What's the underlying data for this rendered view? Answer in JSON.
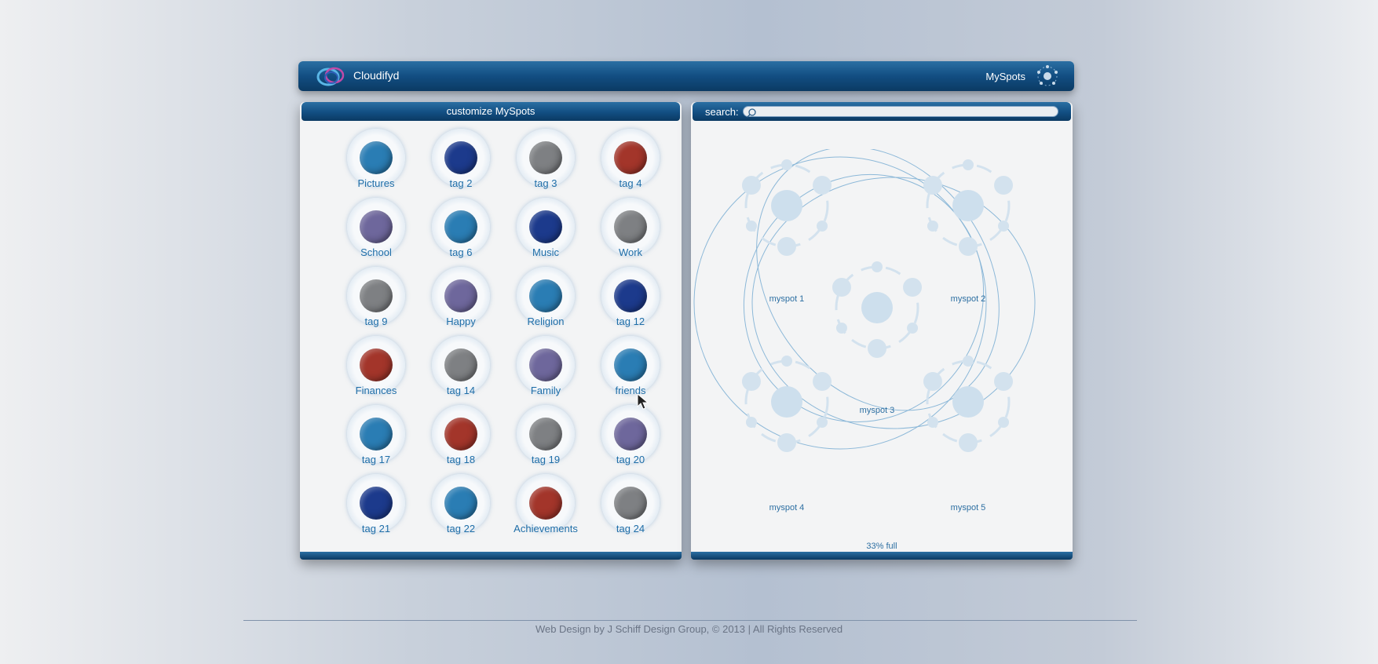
{
  "header": {
    "app_name": "Cloudifyd",
    "myspots_label": "MySpots"
  },
  "left_panel": {
    "title": "customize MySpots",
    "tags": [
      {
        "label": "Pictures",
        "color": "teal-blue"
      },
      {
        "label": "tag 2",
        "color": "navy"
      },
      {
        "label": "tag 3",
        "color": "gray"
      },
      {
        "label": "tag 4",
        "color": "red"
      },
      {
        "label": "School",
        "color": "purple"
      },
      {
        "label": "tag 6",
        "color": "teal-blue"
      },
      {
        "label": "Music",
        "color": "navy"
      },
      {
        "label": "Work",
        "color": "gray"
      },
      {
        "label": "tag 9",
        "color": "gray"
      },
      {
        "label": "Happy",
        "color": "purple"
      },
      {
        "label": "Religion",
        "color": "teal-blue"
      },
      {
        "label": "tag 12",
        "color": "navy"
      },
      {
        "label": "Finances",
        "color": "red"
      },
      {
        "label": "tag 14",
        "color": "gray"
      },
      {
        "label": "Family",
        "color": "purple"
      },
      {
        "label": "friends",
        "color": "teal-blue"
      },
      {
        "label": "tag 17",
        "color": "teal-blue"
      },
      {
        "label": "tag 18",
        "color": "red"
      },
      {
        "label": "tag 19",
        "color": "gray"
      },
      {
        "label": "tag 20",
        "color": "purple"
      },
      {
        "label": "tag 21",
        "color": "navy"
      },
      {
        "label": "tag 22",
        "color": "teal-blue"
      },
      {
        "label": "Achievements",
        "color": "red"
      },
      {
        "label": "tag 24",
        "color": "gray"
      }
    ]
  },
  "palette": {
    "teal-blue": "#2a7db4",
    "navy": "#1c3a8c",
    "gray": "#7e8083",
    "red": "#a3352a",
    "purple": "#6e679c",
    "accent": "#1f6ea8"
  },
  "right_panel": {
    "search_label": "search:",
    "search_value": "",
    "spots": [
      "myspot 1",
      "myspot 2",
      "myspot 3",
      "myspot 4",
      "myspot 5"
    ],
    "fullness": "33% full"
  },
  "footer": {
    "copyright": "Web Design by J Schiff Design Group, © 2013 | All Rights Reserved"
  }
}
